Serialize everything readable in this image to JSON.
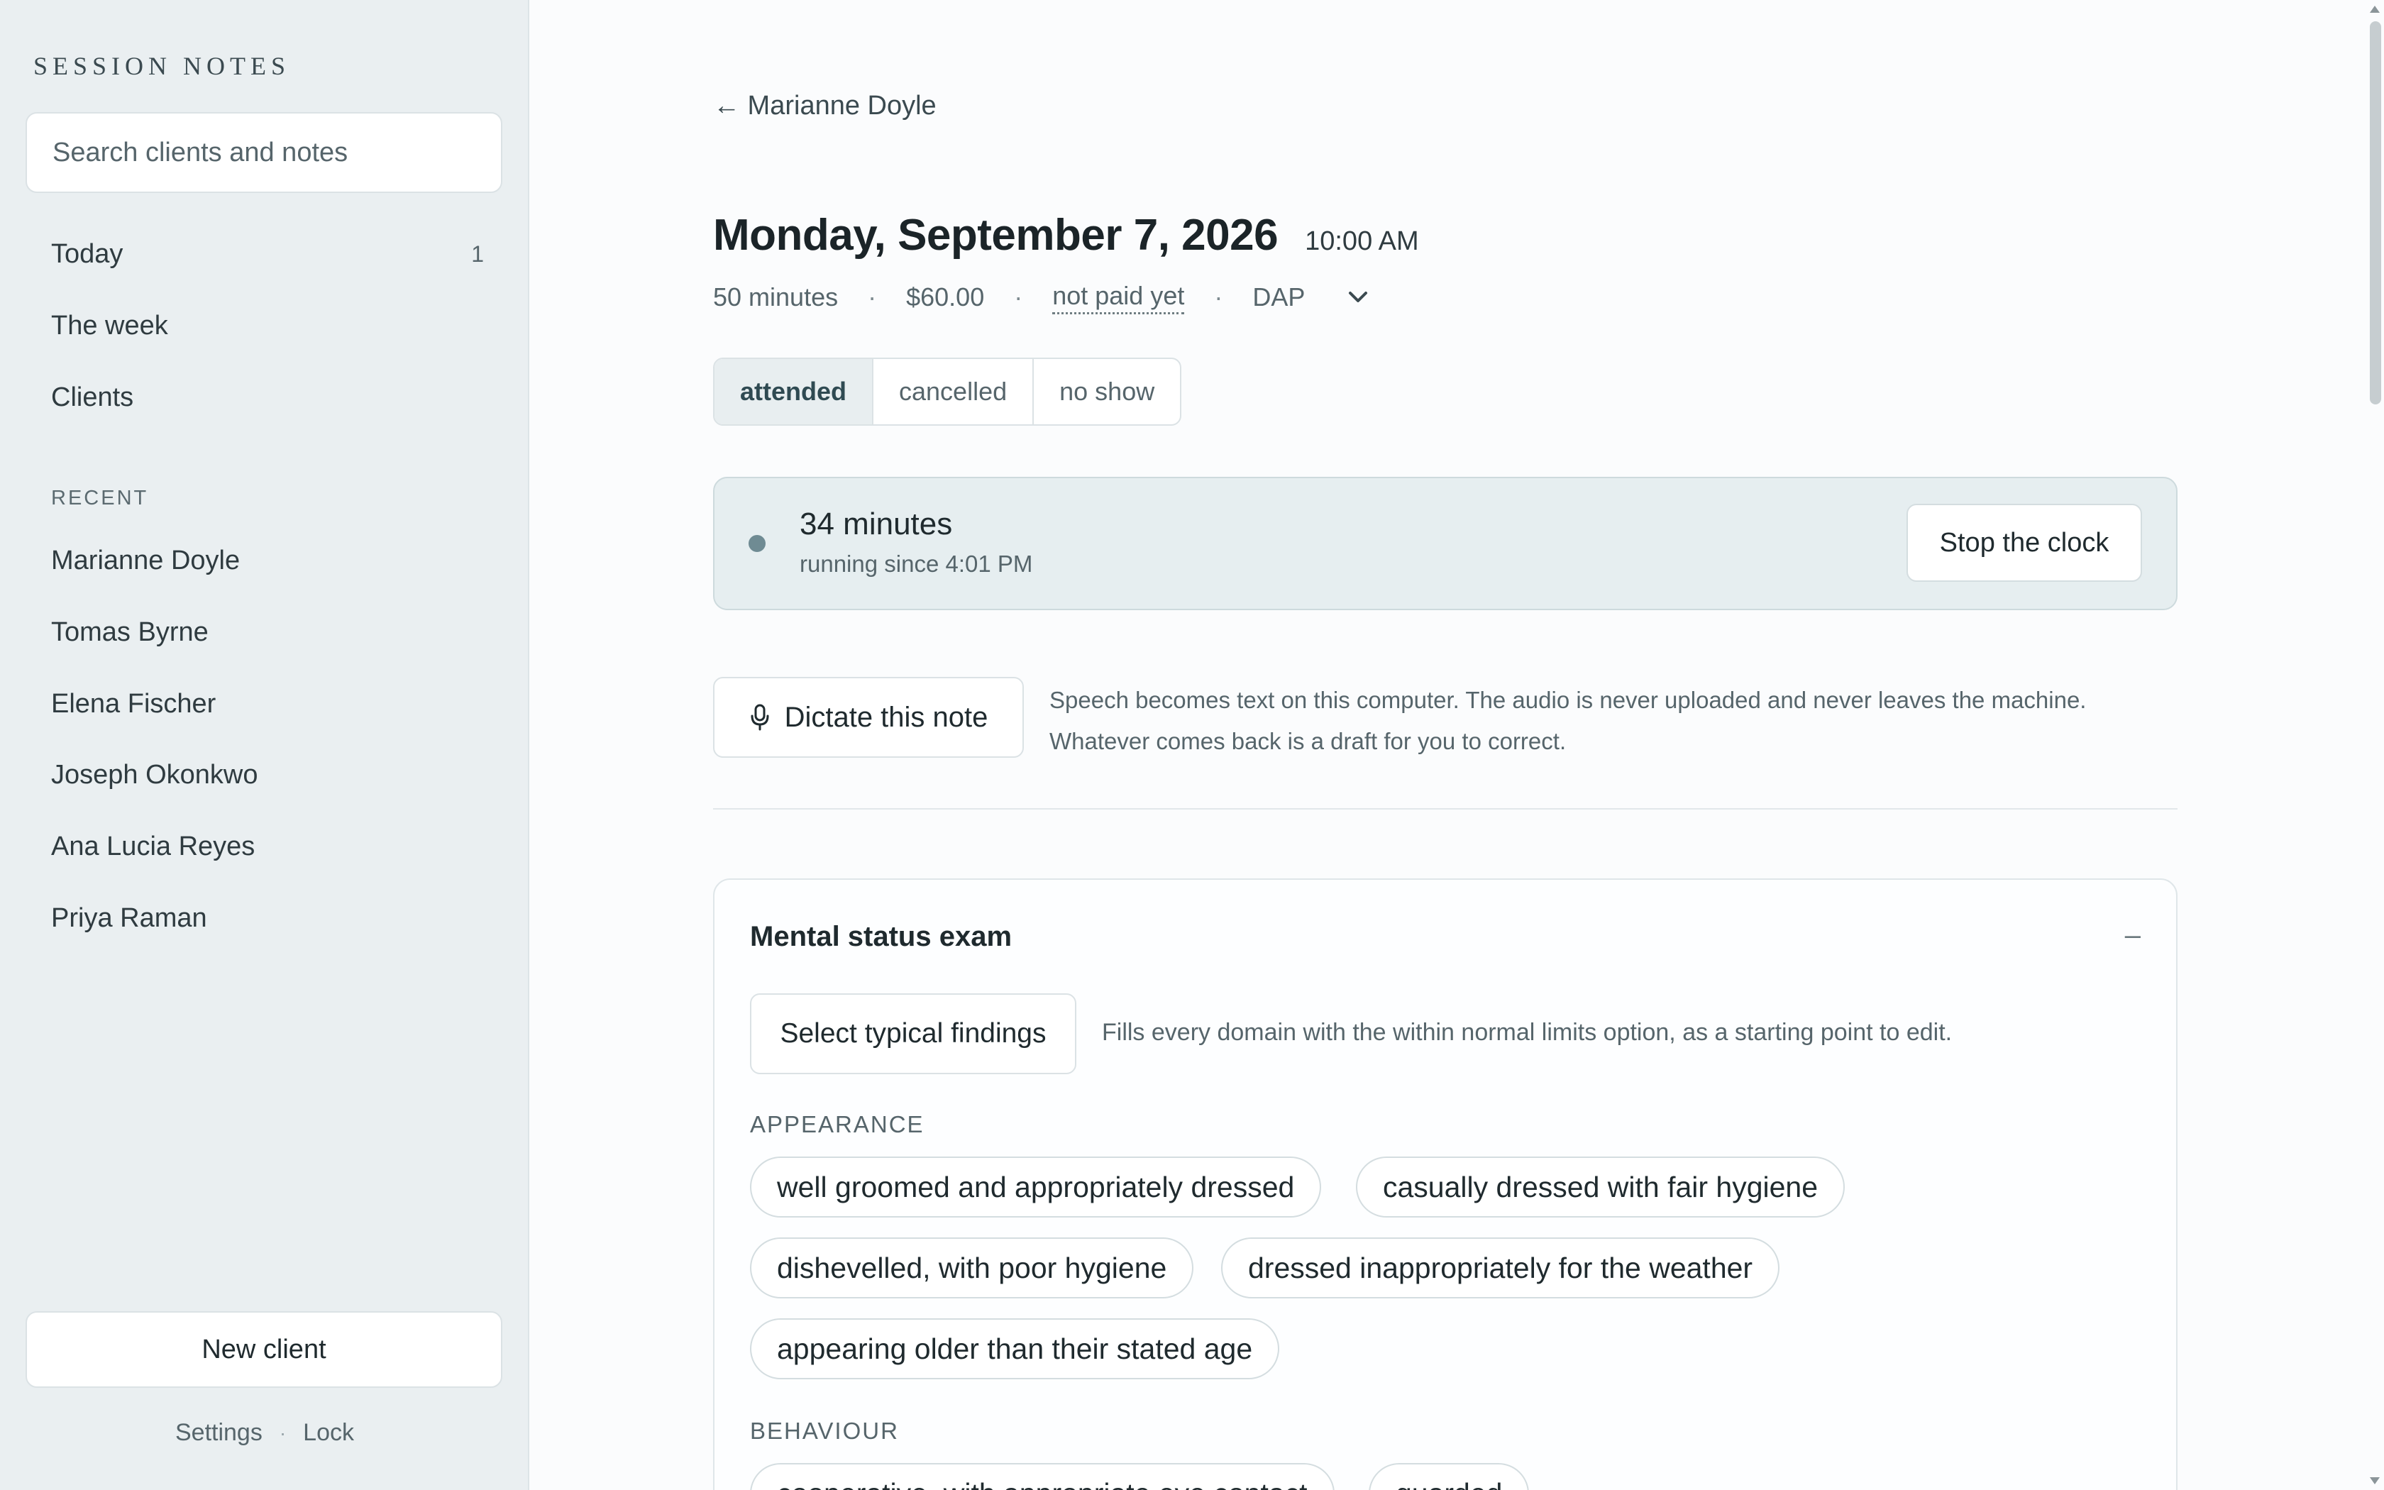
{
  "sidebar": {
    "brand": "SESSION NOTES",
    "search_placeholder": "Search clients and notes",
    "nav": [
      {
        "label": "Today",
        "count": "1"
      },
      {
        "label": "The week",
        "count": ""
      },
      {
        "label": "Clients",
        "count": ""
      }
    ],
    "recent_label": "RECENT",
    "recent": [
      "Marianne Doyle",
      "Tomas Byrne",
      "Elena Fischer",
      "Joseph Okonkwo",
      "Ana Lucia Reyes",
      "Priya Raman"
    ],
    "new_client": "New client",
    "settings": "Settings",
    "separator": "·",
    "lock": "Lock"
  },
  "session": {
    "back": "← Marianne Doyle",
    "date": "Monday, September 7, 2026",
    "time": "10:00 AM",
    "duration": "50 minutes",
    "fee": "$60.00",
    "payment_status": "not paid yet",
    "note_format": "DAP",
    "separator": "·",
    "attendance": {
      "options": [
        "attended",
        "cancelled",
        "no show"
      ],
      "selected": "attended"
    }
  },
  "clock": {
    "minutes": "34 minutes",
    "since": "running since 4:01 PM",
    "stop_label": "Stop the clock"
  },
  "dictation": {
    "button": "Dictate this note",
    "note_line1": "Speech becomes text on this computer. The audio is never uploaded and never leaves the machine.",
    "note_line2": "Whatever comes back is a draft for you to correct."
  },
  "mse": {
    "title": "Mental status exam",
    "collapse": "–",
    "typical_button": "Select typical findings",
    "typical_note": "Fills every domain with the within normal limits option, as a starting point to edit.",
    "appearance_label": "APPEARANCE",
    "appearance": [
      "well groomed and appropriately dressed",
      "casually dressed with fair hygiene",
      "dishevelled, with poor hygiene",
      "dressed inappropriately for the weather",
      "appearing older than their stated age"
    ],
    "behaviour_label": "BEHAVIOUR",
    "behaviour": [
      "cooperative, with appropriate eye contact",
      "guarded"
    ]
  },
  "colors": {
    "sidebar_bg": "#eaeff1",
    "clock_bg": "#e6eef0",
    "accent": "#6f8b93"
  }
}
